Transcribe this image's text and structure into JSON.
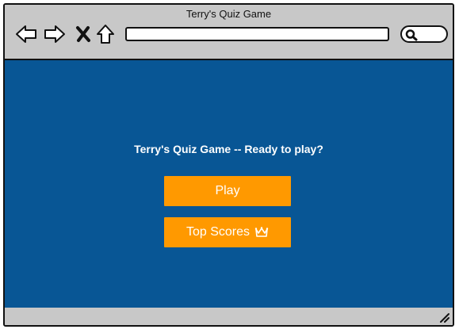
{
  "window": {
    "title": "Terry's Quiz Game"
  },
  "toolbar": {
    "back_icon": "back-arrow-icon",
    "forward_icon": "forward-arrow-icon",
    "stop_icon": "close-icon",
    "home_icon": "home-icon",
    "address_value": "",
    "search_icon": "search-icon"
  },
  "main": {
    "heading": "Terry's Quiz Game -- Ready to play?",
    "play_label": "Play",
    "top_scores_label": "Top Scores",
    "top_scores_icon": "crown-icon"
  },
  "colors": {
    "chrome": "#c8c8c8",
    "background": "#085695",
    "button": "#ff9900",
    "text": "#ffffff"
  }
}
